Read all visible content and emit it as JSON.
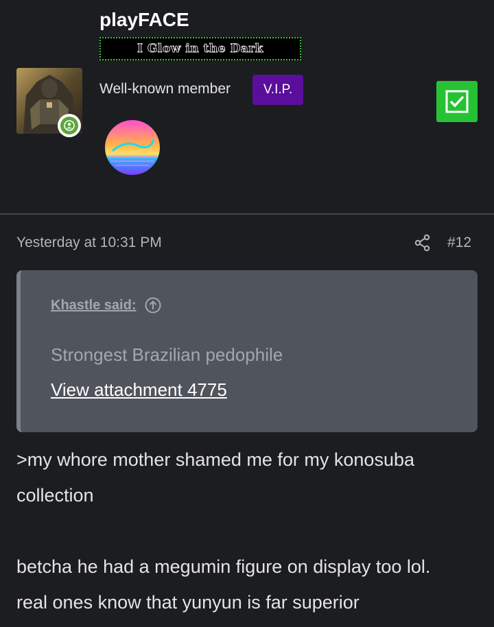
{
  "user": {
    "username": "playFACE",
    "banner": "I Glow in the Dark",
    "member_title": "Well-known member",
    "badge": "V.I.P."
  },
  "post": {
    "time": "Yesterday at 10:31 PM",
    "number": "#12"
  },
  "quote": {
    "author": "Khastle said:",
    "text": "Strongest Brazilian pedophile",
    "attachment": "View attachment 4775"
  },
  "body": {
    "line1": ">my whore mother shamed me for my konosuba",
    "line2": "collection",
    "line3": "betcha he had a megumin figure on display too lol.",
    "line4": "real ones know that yunyun is far superior"
  },
  "colors": {
    "background": "#1c1d20",
    "vip_badge": "#5b0e9c",
    "check_button": "#27c234",
    "online": "#5ba63b",
    "banner_border": "#2ed12e",
    "quote_bg": "#50545c"
  },
  "icons": {
    "online": "user-online-icon",
    "check": "checkbox-checked-icon",
    "share": "share-icon",
    "quote_jump": "arrow-up-circle-icon"
  }
}
